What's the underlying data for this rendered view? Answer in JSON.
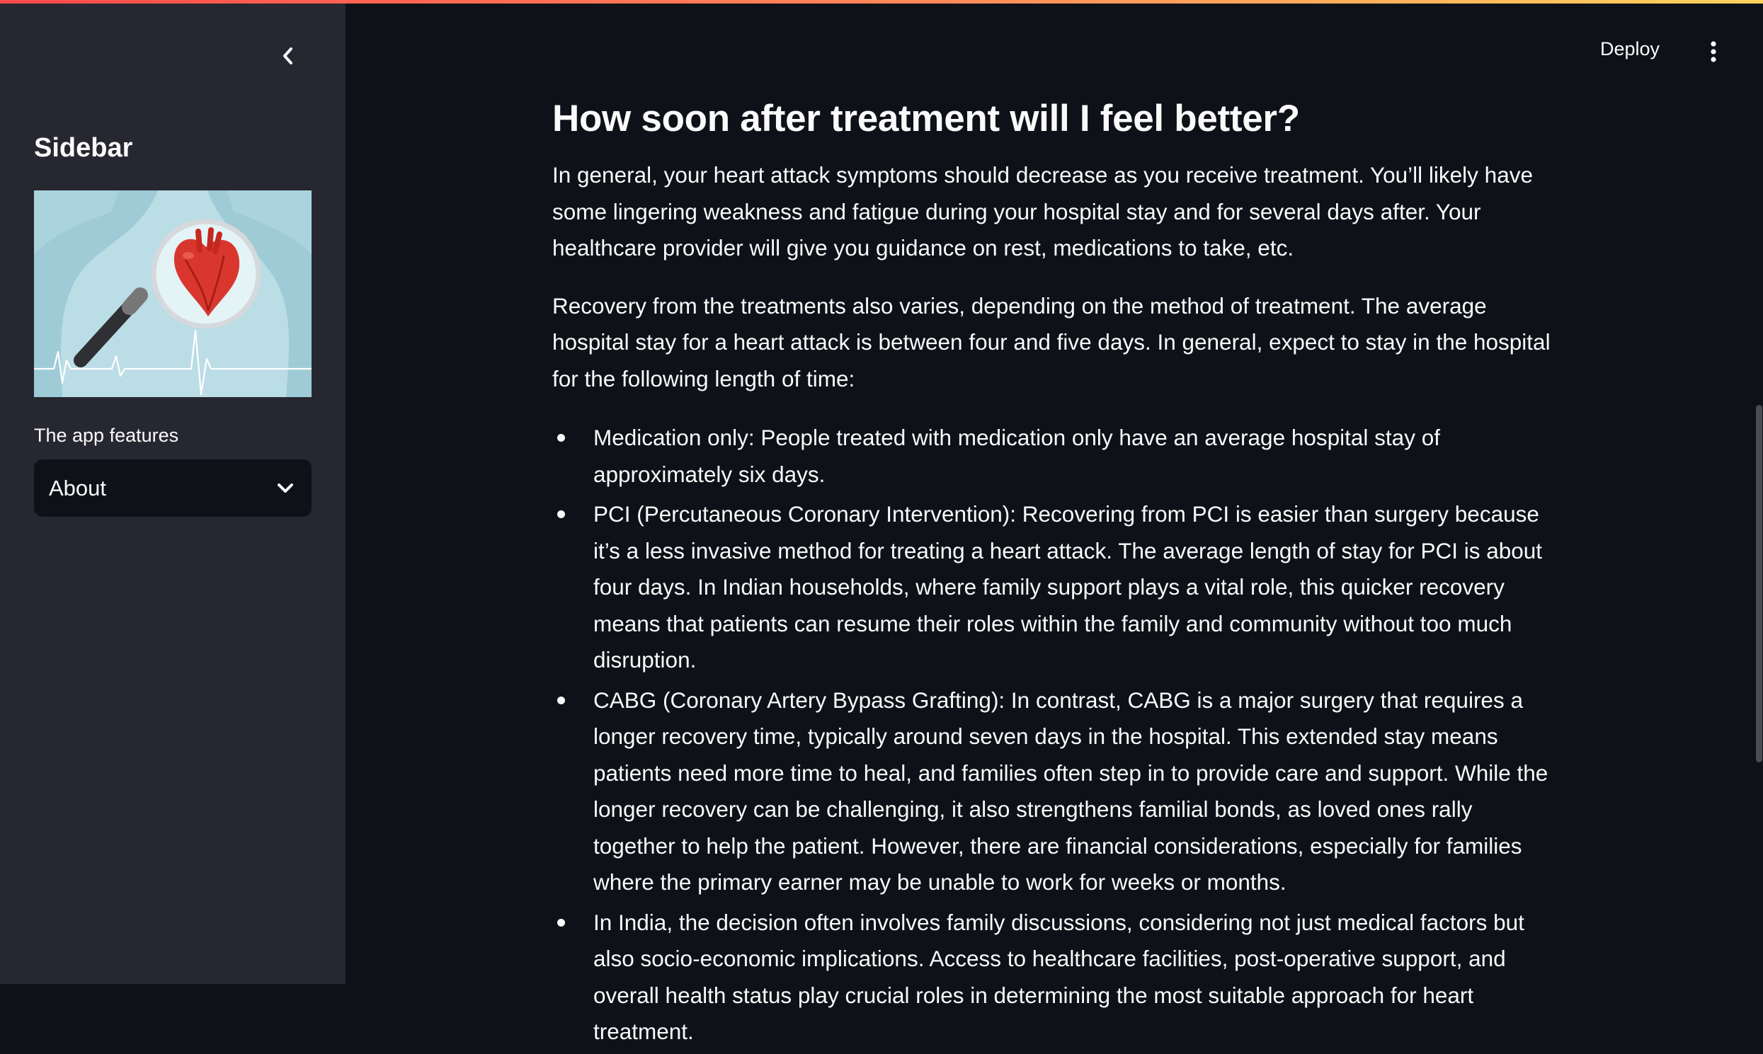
{
  "sidebar": {
    "collapse_icon": "chevron-left-icon",
    "title": "Sidebar",
    "select_label": "The app features",
    "select_value": "About",
    "select_icon": "chevron-down-icon"
  },
  "header": {
    "deploy_label": "Deploy",
    "menu_icon": "vertical-ellipsis-icon"
  },
  "main": {
    "heading": "How soon after treatment will I feel better?",
    "paragraphs": [
      "In general, your heart attack symptoms should decrease as you receive treatment. You’ll likely have some lingering weakness and fatigue during your hospital stay and for several days after. Your healthcare provider will give you guidance on rest, medications to take, etc.",
      "Recovery from the treatments also varies, depending on the method of treatment. The average hospital stay for a heart attack is between four and five days. In general, expect to stay in the hospital for the following length of time:"
    ],
    "list_items": [
      "Medication only: People treated with medication only have an average hospital stay of approximately six days.",
      "PCI (Percutaneous Coronary Intervention): Recovering from PCI is easier than surgery because it’s a less invasive method for treating a heart attack. The average length of stay for PCI is about four days. In Indian households, where family support plays a vital role, this quicker recovery means that patients can resume their roles within the family and community without too much disruption.",
      "CABG (Coronary Artery Bypass Grafting): In contrast, CABG is a major surgery that requires a longer recovery time, typically around seven days in the hospital. This extended stay means patients need more time to heal, and families often step in to provide care and support. While the longer recovery can be challenging, it also strengthens familial bonds, as loved ones rally together to help the patient. However, there are financial considerations, especially for families where the primary earner may be unable to work for weeks or months.",
      "In India, the decision often involves family discussions, considering not just medical factors but also socio-economic implications. Access to healthcare facilities, post-operative support, and overall health status play crucial roles in determining the most suitable approach for heart treatment."
    ]
  },
  "colors": {
    "app_background": "#0e1117",
    "sidebar_background": "#262730",
    "text": "#fafafa",
    "accent_gradient_start": "#ff4b4b",
    "accent_gradient_end": "#fdd35c",
    "image_background": "#9ecbd6"
  }
}
